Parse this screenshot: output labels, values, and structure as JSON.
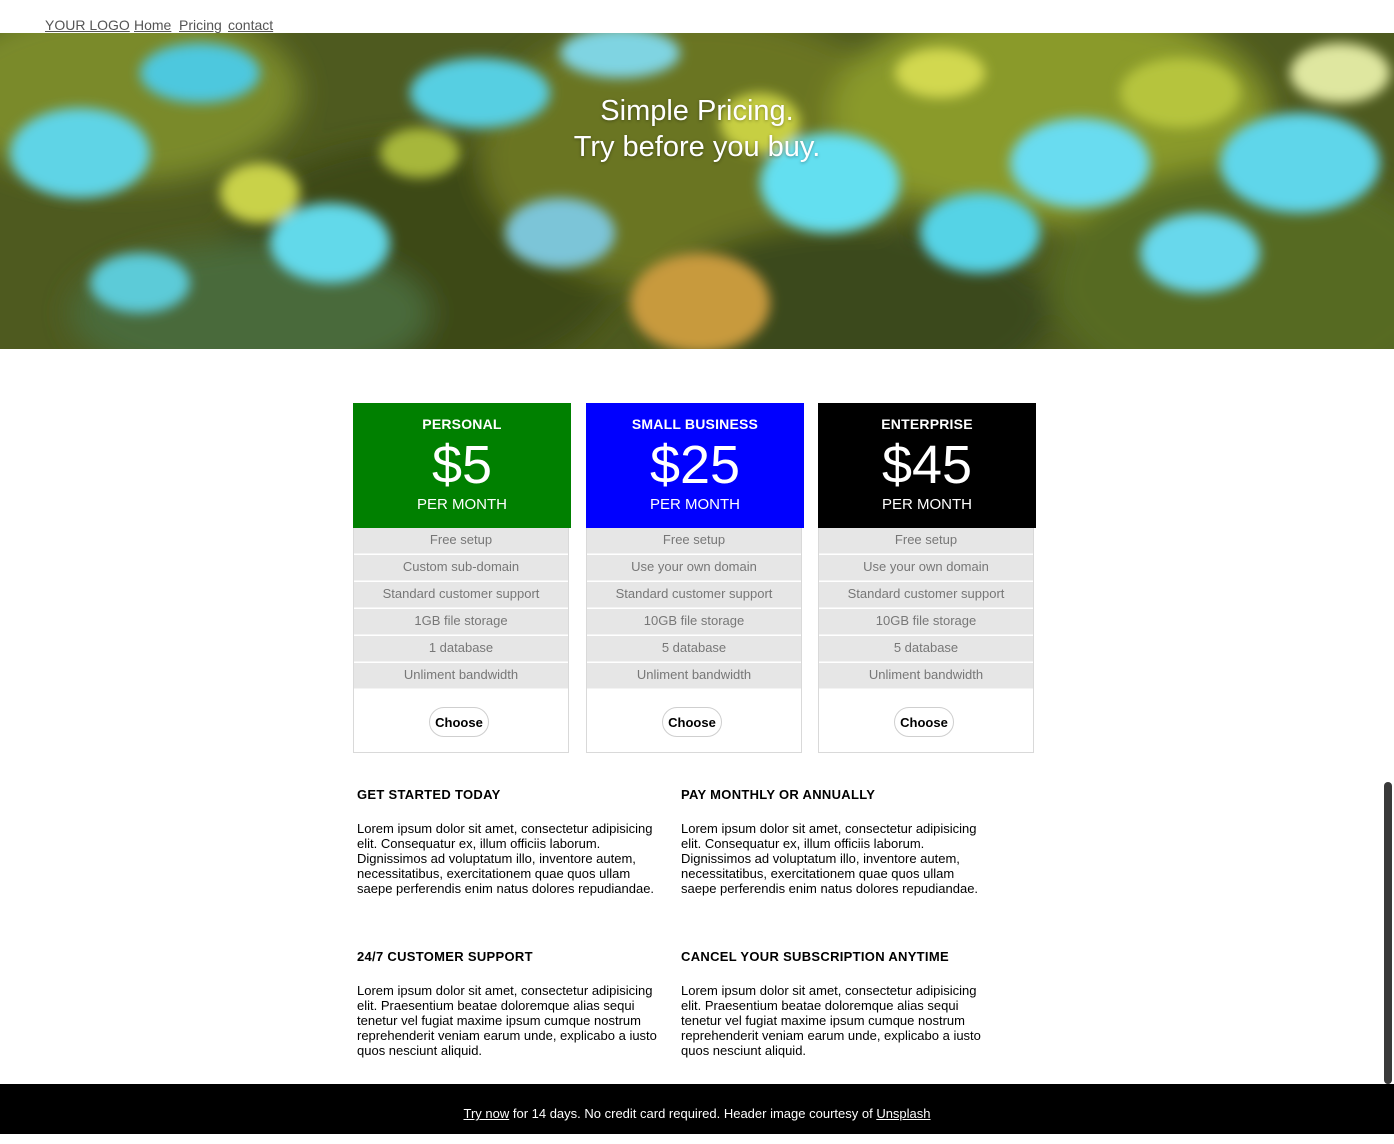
{
  "nav": {
    "logo": "YOUR LOGO",
    "links": [
      "Home",
      "Pricing",
      "contact"
    ]
  },
  "hero": {
    "line1": "Simple Pricing.",
    "line2": "Try before you buy."
  },
  "plans": [
    {
      "name": "PERSONAL",
      "price": "$5",
      "period": "PER MONTH",
      "color": "#008000",
      "features": [
        "Free setup",
        "Custom sub-domain",
        "Standard customer support",
        "1GB file storage",
        "1 database",
        "Unliment bandwidth"
      ],
      "button": "Choose"
    },
    {
      "name": "SMALL BUSINESS",
      "price": "$25",
      "period": "PER MONTH",
      "color": "#0000ff",
      "features": [
        "Free setup",
        "Use your own domain",
        "Standard customer support",
        "10GB file storage",
        "5 database",
        "Unliment bandwidth"
      ],
      "button": "Choose"
    },
    {
      "name": "ENTERPRISE",
      "price": "$45",
      "period": "PER MONTH",
      "color": "#000000",
      "features": [
        "Free setup",
        "Use your own domain",
        "Standard customer support",
        "10GB file storage",
        "5 database",
        "Unliment bandwidth"
      ],
      "button": "Choose"
    }
  ],
  "info": [
    {
      "title": "GET STARTED TODAY",
      "text": "Lorem ipsum dolor sit amet, consectetur adipisicing elit. Consequatur ex, illum officiis laborum. Dignissimos ad voluptatum illo, inventore autem, necessitatibus, exercitationem quae quos ullam saepe perferendis enim natus dolores repudiandae."
    },
    {
      "title": "PAY MONTHLY OR ANNUALLY",
      "text": "Lorem ipsum dolor sit amet, consectetur adipisicing elit. Consequatur ex, illum officiis laborum. Dignissimos ad voluptatum illo, inventore autem, necessitatibus, exercitationem quae quos ullam saepe perferendis enim natus dolores repudiandae."
    },
    {
      "title": "24/7 CUSTOMER SUPPORT",
      "text": "Lorem ipsum dolor sit amet, consectetur adipisicing elit. Praesentium beatae doloremque alias sequi tenetur vel fugiat maxime ipsum cumque nostrum reprehenderit veniam earum unde, explicabo a iusto quos nesciunt aliquid."
    },
    {
      "title": "CANCEL YOUR SUBSCRIPTION ANYTIME",
      "text": "Lorem ipsum dolor sit amet, consectetur adipisicing elit. Praesentium beatae doloremque alias sequi tenetur vel fugiat maxime ipsum cumque nostrum reprehenderit veniam earum unde, explicabo a iusto quos nesciunt aliquid."
    }
  ],
  "footer": {
    "link_try": "Try now",
    "text_mid": " for 14 days. No credit card required. Header image courtesy of ",
    "link_credit": "Unsplash"
  }
}
